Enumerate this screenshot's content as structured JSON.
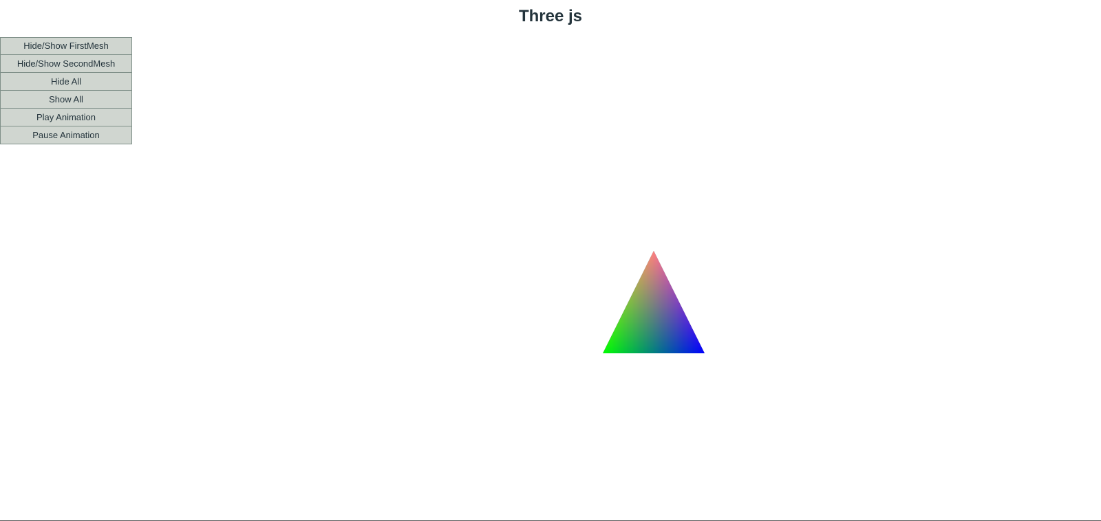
{
  "header": {
    "title": "Three js"
  },
  "controls": {
    "buttons": [
      {
        "label": "Hide/Show FirstMesh"
      },
      {
        "label": "Hide/Show SecondMesh"
      },
      {
        "label": "Hide All"
      },
      {
        "label": "Show All"
      },
      {
        "label": "Play Animation"
      },
      {
        "label": "Pause Animation"
      }
    ]
  },
  "scene": {
    "background": "#ffffff",
    "mesh": {
      "shape": "triangle",
      "vertex_colors": {
        "top": "#ff0000",
        "bottom_left": "#00ff00",
        "bottom_right": "#0000ff"
      }
    }
  },
  "colors": {
    "title": "#24343c",
    "button_background": "#d0d6d0",
    "button_border": "#7e8f88",
    "button_text": "#24343c"
  }
}
